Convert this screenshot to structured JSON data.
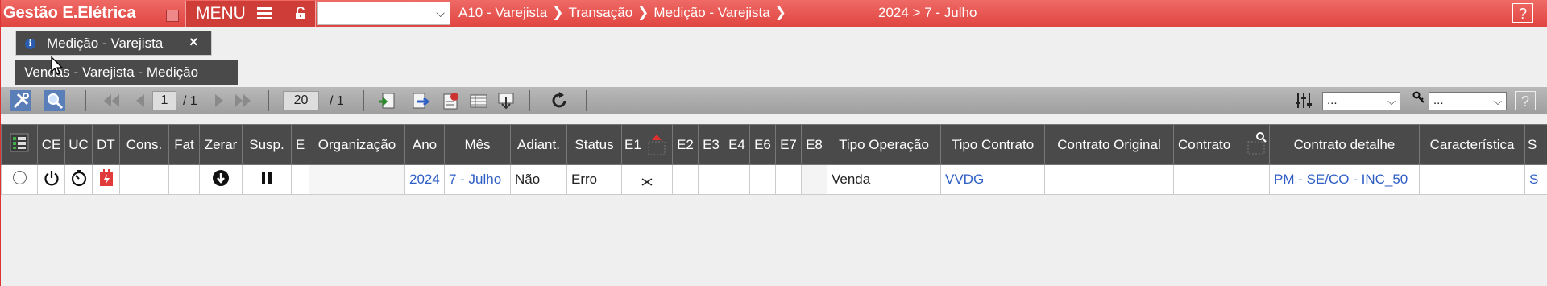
{
  "app": {
    "title": "Gestão E.Elétrica",
    "menu_label": "MENU",
    "select_value": "",
    "breadcrumb": [
      "A10 - Varejista",
      "Transação",
      "Medição - Varejista"
    ],
    "period": "2024 > 7 - Julho",
    "help": "?"
  },
  "tabs": {
    "main": "Medição - Varejista",
    "close": "×",
    "sub": "Vendas - Varejista - Medição"
  },
  "toolbar": {
    "page_current": "1",
    "page_total": "/ 1",
    "page_size": "20",
    "page_size_total": "/ 1",
    "select1": "...",
    "select2": "...",
    "help": "?"
  },
  "table": {
    "columns": [
      "",
      "CE",
      "UC",
      "DT",
      "Cons.",
      "Fat",
      "Zerar",
      "Susp.",
      "E",
      "Organização",
      "Ano",
      "Mês",
      "Adiant.",
      "Status",
      "E1",
      "E2",
      "E3",
      "E4",
      "E6",
      "E7",
      "E8",
      "Tipo Operação",
      "Tipo Contrato",
      "Contrato Original",
      "Contrato",
      "Contrato detalhe",
      "Característica",
      "S"
    ],
    "row": {
      "organizacao": "",
      "ano": "2024",
      "mes": "7 - Julho",
      "adiant": "Não",
      "status": "Erro",
      "tipo_operacao": "Venda",
      "tipo_contrato": "VVDG",
      "contrato_original": "",
      "contrato": "",
      "contrato_detalhe": "PM - SE/CO - INC_50",
      "caracteristica": "",
      "s": "S"
    }
  },
  "colors": {
    "topbar": "#e0443f",
    "header": "#4a4a4a",
    "link": "#2f5fc4"
  }
}
